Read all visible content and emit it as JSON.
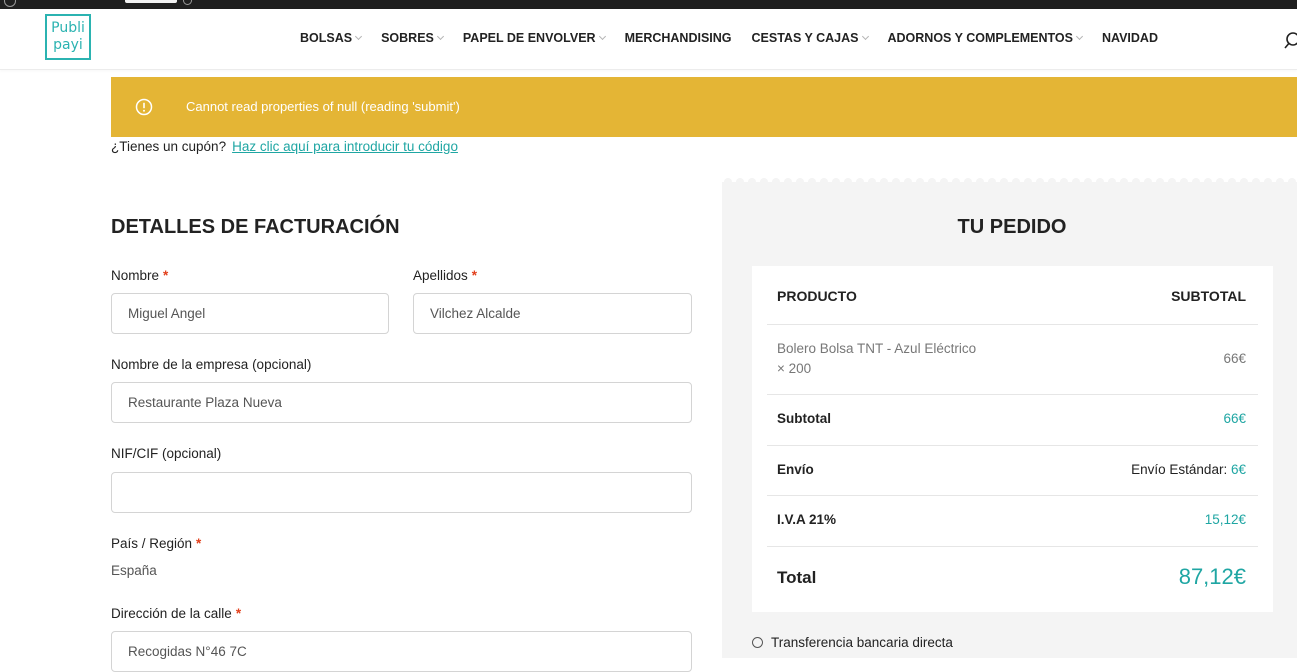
{
  "colors": {
    "accent": "#1fa6a3",
    "alert": "#e4b535",
    "required": "#e2401c",
    "order_bg": "#f4f4f4"
  },
  "logo": {
    "line1": "Publi",
    "line2": "payi"
  },
  "nav": [
    {
      "label": "BOLSAS",
      "dropdown": true
    },
    {
      "label": "SOBRES",
      "dropdown": true
    },
    {
      "label": "PAPEL DE ENVOLVER",
      "dropdown": true
    },
    {
      "label": "MERCHANDISING",
      "dropdown": false
    },
    {
      "label": "CESTAS Y CAJAS",
      "dropdown": true
    },
    {
      "label": "ADORNOS Y COMPLEMENTOS",
      "dropdown": true
    },
    {
      "label": "NAVIDAD",
      "dropdown": false
    }
  ],
  "alert": {
    "icon": "info-circle-icon",
    "message": "Cannot read properties of null (reading 'submit')"
  },
  "coupon": {
    "text": "¿Tienes un cupón?",
    "link": "Haz clic aquí para introducir tu código"
  },
  "billing": {
    "title": "DETALLES DE FACTURACIÓN",
    "first_name": {
      "label": "Nombre",
      "required": "*",
      "value": "Miguel Angel"
    },
    "last_name": {
      "label": "Apellidos",
      "required": "*",
      "value": "Vilchez Alcalde"
    },
    "company": {
      "label": "Nombre de la empresa (opcional)",
      "value": "Restaurante Plaza Nueva"
    },
    "nif": {
      "label": "NIF/CIF (opcional)",
      "value": ""
    },
    "country": {
      "label": "País / Región",
      "required": "*",
      "value": "España"
    },
    "street": {
      "label": "Dirección de la calle",
      "required": "*",
      "value": "Recogidas N°46 7C"
    }
  },
  "order": {
    "title": "TU PEDIDO",
    "col_product": "PRODUCTO",
    "col_subtotal": "SUBTOTAL",
    "item": {
      "name": "Bolero Bolsa TNT - Azul Eléctrico",
      "qty": "× 200",
      "price": "66€"
    },
    "subtotal": {
      "label": "Subtotal",
      "value": "66€"
    },
    "shipping": {
      "label": "Envío",
      "method": "Envío Estándar:",
      "value": "6€"
    },
    "tax": {
      "label": "I.V.A 21%",
      "value": "15,12€"
    },
    "total": {
      "label": "Total",
      "value": "87,12€"
    }
  },
  "payment": {
    "option1": "Transferencia bancaria directa"
  }
}
